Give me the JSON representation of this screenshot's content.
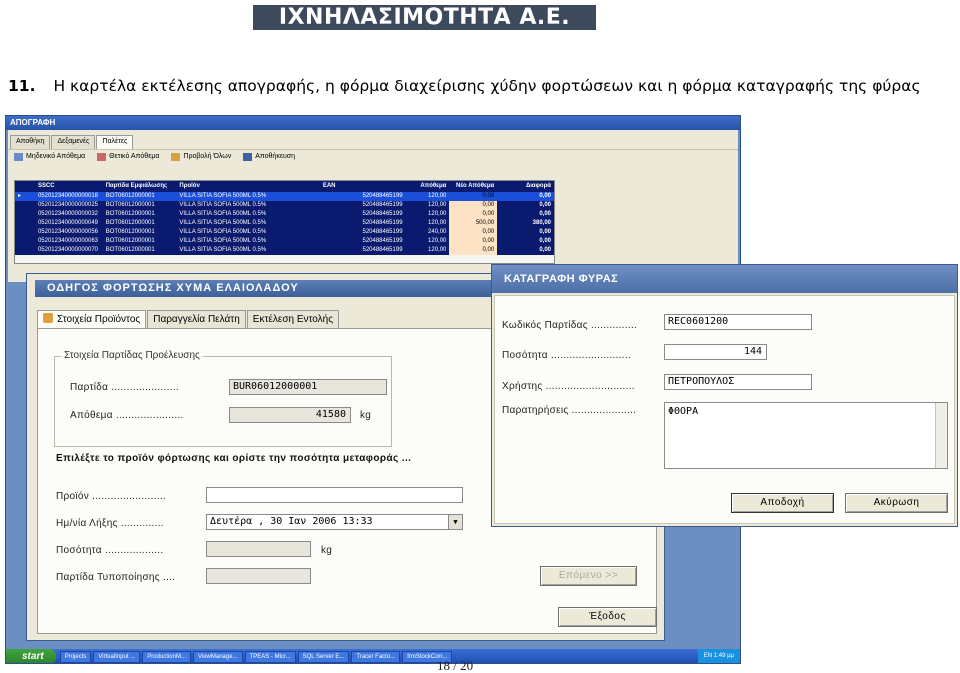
{
  "header": {
    "company": "ΙΧΝΗΛΑΣΙΜΟΤΗΤΑ Α.Ε."
  },
  "caption": {
    "number": "11.",
    "text": "Η καρτέλα εκτέλεσης απογραφής, η φόρμα διαχείρισης χύδην φορτώσεων και η φόρμα καταγραφής της φύρας"
  },
  "inventory_window": {
    "title": "ΑΠΟΓΡΑΦΗ",
    "tabs": [
      "Αποθήκη",
      "Δεξαμενές",
      "Παλέτες"
    ],
    "toolbar": [
      "Μηδενικό Απόθεμα",
      "Θετικό Απόθεμα",
      "Προβολή Όλων",
      "Αποθήκευση"
    ],
    "columns": [
      "",
      "SSCC",
      "Παρτίδα Εμφιάλωσης",
      "Προϊόν",
      "EAN",
      "Απόθεμα",
      "Νέο Απόθεμα",
      "Διαφορά"
    ],
    "rows": [
      [
        "▸",
        "052012340000000018",
        "BOT06012000001",
        "VILLA SITIA SOFIA 500ML 0.5%",
        "520488465199",
        "120,00",
        "0,00",
        "0,00"
      ],
      [
        "",
        "052012340000000025",
        "BOT06012000001",
        "VILLA SITIA SOFIA 500ML 0.5%",
        "520488465199",
        "120,00",
        "0,00",
        "0,00"
      ],
      [
        "",
        "052012340000000032",
        "BOT06012000001",
        "VILLA SITIA SOFIA 500ML 0.5%",
        "520488465199",
        "120,00",
        "0,00",
        "0,00"
      ],
      [
        "",
        "052012340000000049",
        "BOT06012000001",
        "VILLA SITIA SOFIA 500ML 0.5%",
        "520488465199",
        "120,00",
        "500,00",
        "380,00"
      ],
      [
        "",
        "052012340000000056",
        "BOT06012000001",
        "VILLA SITIA SOFIA 500ML 0.5%",
        "520488465199",
        "240,00",
        "0,00",
        "0,00"
      ],
      [
        "",
        "052012340000000063",
        "BOT06012000001",
        "VILLA SITIA SOFIA 500ML 0.5%",
        "520488465199",
        "120,00",
        "0,00",
        "0,00"
      ],
      [
        "",
        "052012340000000070",
        "BOT06012000001",
        "VILLA SITIA SOFIA 500ML 0.5%",
        "520488465199",
        "120,00",
        "0,00",
        "0,00"
      ]
    ]
  },
  "loading_wizard": {
    "title": "ΟΔΗΓΟΣ ΦΟΡΤΩΣΗΣ ΧΥΜΑ ΕΛΑΙΟΛΑΔΟΥ",
    "tabs": [
      "Στοιχεία Προϊόντος",
      "Παραγγελία Πελάτη",
      "Εκτέλεση Εντολής"
    ],
    "group_title": "Στοιχεία Παρτίδας Προέλευσης",
    "batch_label": "Παρτίδα ......................",
    "batch_value": "BUR06012000001",
    "stock_label": "Απόθεμα ......................",
    "stock_value": "41580",
    "stock_unit": "kg",
    "instruction": "Επιλέξτε το προϊόν φόρτωσης και ορίστε την ποσότητα μεταφοράς ...",
    "product_label": "Προϊόν ........................",
    "product_value": "",
    "expiry_label": "Ημ/νία Λήξης ..............",
    "expiry_value": "Δευτέρα  , 30 Ιαν 2006 13:33",
    "quantity_label": "Ποσότητα ...................",
    "quantity_value": "",
    "quantity_unit": "kg",
    "packing_batch_label": "Παρτίδα Τυποποίησης ....",
    "packing_batch_value": "",
    "next_button": "Επόμενο >>",
    "exit_button": "Έξοδος"
  },
  "waste_form": {
    "title": "ΚΑΤΑΓΡΑΦΗ ΦΥΡΑΣ",
    "batch_code_label": "Κωδικός Παρτίδας ...............",
    "batch_code_value": "REC0601200",
    "quantity_label": "Ποσότητα ..........................",
    "quantity_value": "144",
    "user_label": "Χρήστης .............................",
    "user_value": "ΠΕΤΡΟΠΟΥΛΟΣ",
    "remarks_label": "Παρατηρήσεις .....................",
    "remarks_value": "ΦΘΟΡΑ",
    "accept_button": "Αποδοχή",
    "cancel_button": "Ακύρωση"
  },
  "taskbar": {
    "start": "start",
    "items": [
      "Projects",
      "VirtualInput ...",
      "ProductionM...",
      "ViewManage...",
      "TPEAS - Micr...",
      "SQL Server E...",
      "Tracer Facto...",
      "frmStockCorr..."
    ],
    "tray": "EN  1:49 μμ"
  },
  "page_number": "18 / 20"
}
